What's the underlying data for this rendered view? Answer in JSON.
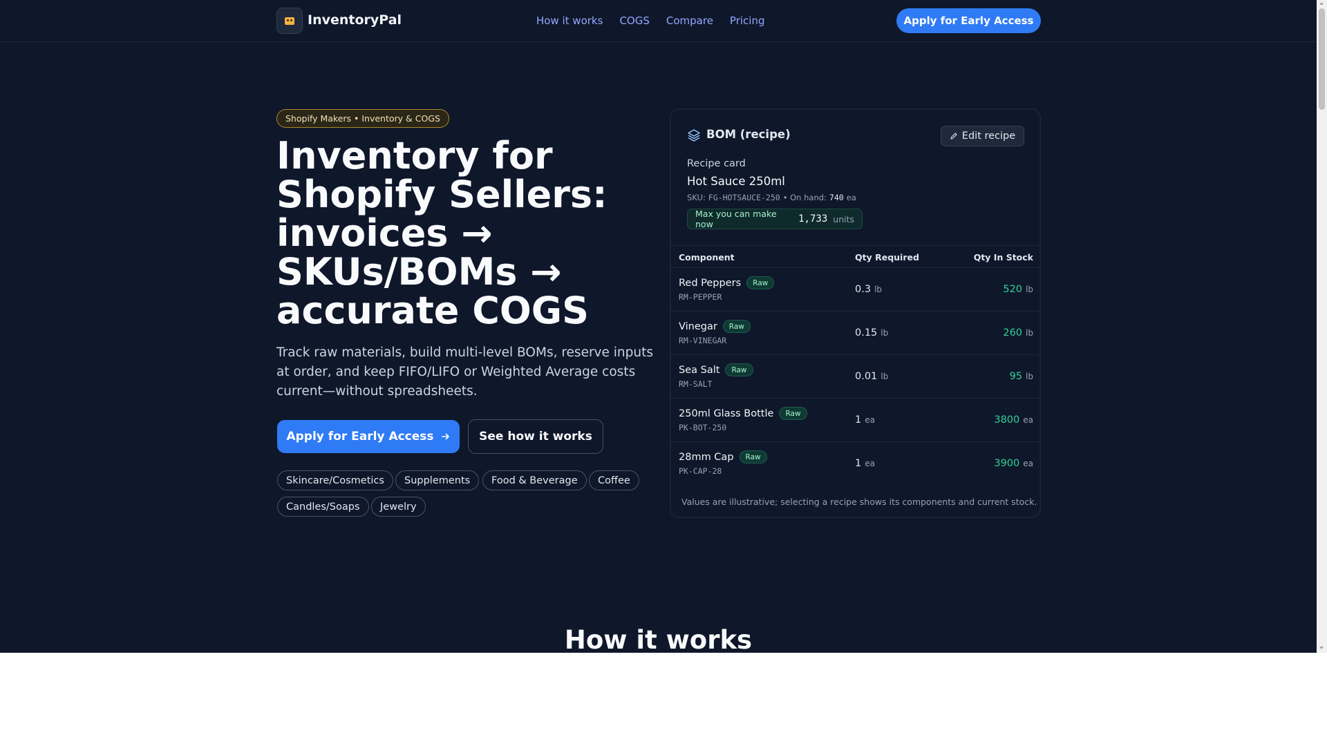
{
  "header": {
    "brand": "InventoryPal",
    "nav": [
      "How it works",
      "COGS",
      "Compare",
      "Pricing"
    ],
    "cta": "Apply for Early Access"
  },
  "hero": {
    "tag": "Shopify Makers • Inventory & COGS",
    "title_lines": [
      "Inventory for",
      "Shopify Sellers:",
      "invoices →",
      "SKUs/BOMs →",
      "accurate COGS"
    ],
    "subtitle": "Track raw materials, build multi-level BOMs, reserve inputs at order, and keep FIFO/LIFO or Weighted Average costs current—without spreadsheets.",
    "primary_cta": "Apply for Early Access",
    "secondary_cta": "See how it works",
    "chips": [
      "Skincare/Cosmetics",
      "Supplements",
      "Food & Beverage",
      "Coffee",
      "Candles/Soaps",
      "Jewelry"
    ]
  },
  "card": {
    "title": "BOM (recipe)",
    "edit_label": "Edit recipe",
    "recipe_label": "Recipe card",
    "recipe_name": "Hot Sauce 250ml",
    "sku_label": "SKU:",
    "sku": "FG-HOTSAUCE-250",
    "on_hand_label": "• On hand:",
    "on_hand": "740",
    "on_hand_unit": "ea",
    "max_label": "Max you can make now",
    "max_value": "1,733",
    "max_unit": "units",
    "columns": [
      "Component",
      "Qty Required",
      "Qty In Stock"
    ],
    "badge": "Raw",
    "rows": [
      {
        "name": "Red Peppers",
        "sku": "RM-PEPPER",
        "req": "0.3",
        "req_unit": "lb",
        "stock": "520",
        "stock_unit": "lb"
      },
      {
        "name": "Vinegar",
        "sku": "RM-VINEGAR",
        "req": "0.15",
        "req_unit": "lb",
        "stock": "260",
        "stock_unit": "lb"
      },
      {
        "name": "Sea Salt",
        "sku": "RM-SALT",
        "req": "0.01",
        "req_unit": "lb",
        "stock": "95",
        "stock_unit": "lb"
      },
      {
        "name": "250ml Glass Bottle",
        "sku": "PK-BOT-250",
        "req": "1",
        "req_unit": "ea",
        "stock": "3800",
        "stock_unit": "ea"
      },
      {
        "name": "28mm Cap",
        "sku": "PK-CAP-28",
        "req": "1",
        "req_unit": "ea",
        "stock": "3900",
        "stock_unit": "ea"
      }
    ],
    "note": "Values are illustrative; selecting a recipe shows its components and current stock."
  },
  "section": {
    "title": "How it works"
  },
  "colors": {
    "background": "#0f172a",
    "accent": "#2f7bf5",
    "stock_green": "#34d399",
    "nav_link": "#93a8ff"
  }
}
